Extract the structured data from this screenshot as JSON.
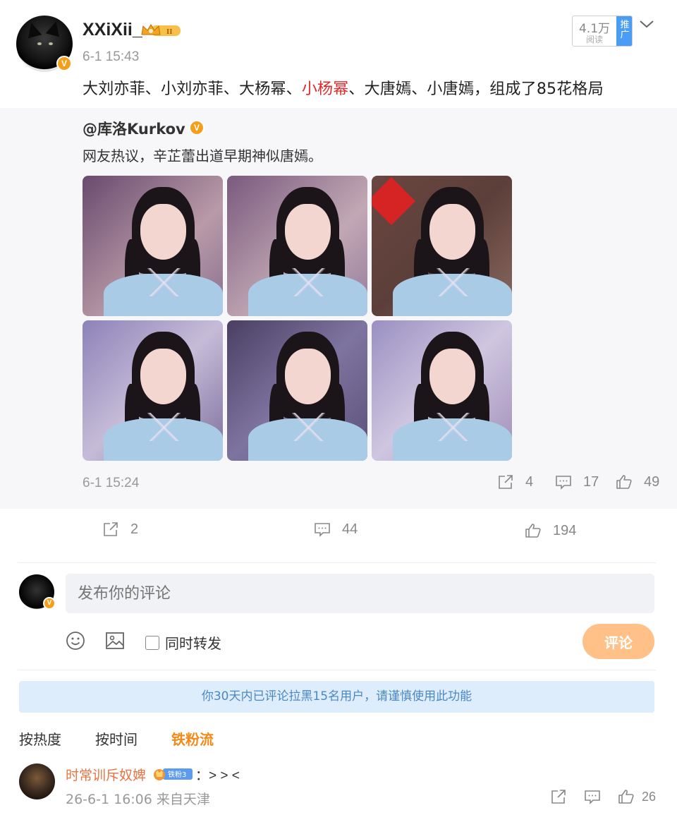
{
  "post": {
    "username": "XXiXii_",
    "time": "6-1 15:43",
    "read_count": "4.1万",
    "read_label": "阅读",
    "promo_label": "推广",
    "text_before": "大刘亦菲、小刘亦菲、大杨幂、",
    "text_highlight": "小杨幂",
    "text_after": "、大唐嫣、小唐嫣，组成了85花格局",
    "actions": {
      "repost": "2",
      "comment": "44",
      "like": "194"
    }
  },
  "repost": {
    "author": "@库洛Kurkov",
    "text": "网友热议，辛芷蕾出道早期神似唐嫣。",
    "time": "6-1 15:24",
    "actions": {
      "repost": "4",
      "comment": "17",
      "like": "49"
    }
  },
  "composer": {
    "placeholder": "发布你的评论",
    "also_repost_label": "同时转发",
    "submit_label": "评论"
  },
  "notice": "你30天内已评论拉黑15名用户，请谨慎使用此功能",
  "sort_tabs": [
    "按热度",
    "按时间",
    "铁粉流"
  ],
  "comment": {
    "username": "时常训斥奴婢",
    "fan_badge": "铁粉3",
    "text": "：> > <",
    "meta": "26-6-1 16:06 来自天津",
    "like_count": "26"
  },
  "colors": {
    "accent_orange": "#f28a1a",
    "highlight_red": "#e02a2a",
    "submit_disabled": "#ffc187",
    "notice_bg": "#deedfb"
  }
}
